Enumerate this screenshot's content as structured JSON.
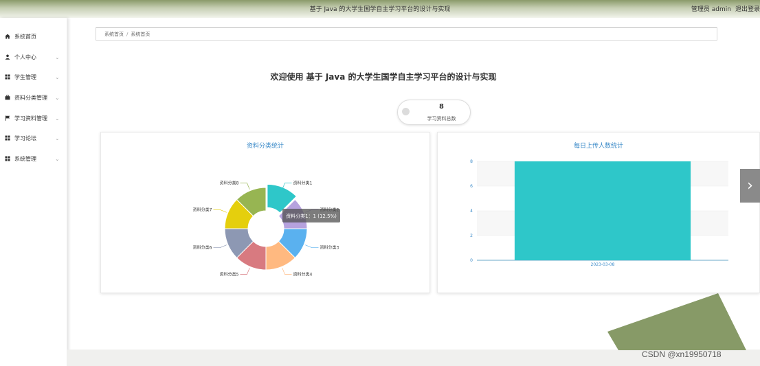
{
  "header": {
    "title": "基于 Java 的大学生国学自主学习平台的设计与实现",
    "user": "管理员 admin",
    "logout": "退出登录"
  },
  "sidebar": {
    "items": [
      {
        "label": "系统首页",
        "icon": "home-icon",
        "has_arrow": false
      },
      {
        "label": "个人中心",
        "icon": "user-icon",
        "has_arrow": true
      },
      {
        "label": "学生管理",
        "icon": "grid-icon",
        "has_arrow": true
      },
      {
        "label": "资料分类管理",
        "icon": "briefcase-icon",
        "has_arrow": true
      },
      {
        "label": "学习资料管理",
        "icon": "flag-icon",
        "has_arrow": true
      },
      {
        "label": "学习论坛",
        "icon": "grid-icon",
        "has_arrow": true
      },
      {
        "label": "系统管理",
        "icon": "grid-icon",
        "has_arrow": true
      }
    ]
  },
  "breadcrumb": {
    "items": [
      "系统首页",
      "系统首页"
    ],
    "separator": "/"
  },
  "welcome": "欢迎使用 基于 Java 的大学生国学自主学习平台的设计与实现",
  "stats": {
    "value": "8",
    "label": "学习资料总数"
  },
  "pie_panel": {
    "title": "资料分类统计"
  },
  "bar_panel": {
    "title": "每日上传人数统计"
  },
  "tooltip": "资料分类1：1 (12.5%)",
  "watermark": "CSDN @xn19950718",
  "colors": {
    "accent": "#3a8ac8",
    "header_green": "#8a9a6a",
    "bar": "#2ec7c9"
  },
  "chart_data": [
    {
      "type": "pie",
      "title": "资料分类统计",
      "variant": "donut",
      "categories": [
        "资料分类1",
        "资料分类2",
        "资料分类3",
        "资料分类4",
        "资料分类5",
        "资料分类6",
        "资料分类7",
        "资料分类8"
      ],
      "values": [
        1,
        1,
        1,
        1,
        1,
        1,
        1,
        1
      ],
      "colors": [
        "#2ec7c9",
        "#b6a2de",
        "#5ab1ef",
        "#ffb980",
        "#d87a80",
        "#8d98b3",
        "#e5cf0d",
        "#97b552"
      ],
      "highlighted": "资料分类1"
    },
    {
      "type": "bar",
      "title": "每日上传人数统计",
      "categories": [
        "2023-03-08"
      ],
      "values": [
        8
      ],
      "ylim": [
        0,
        8
      ],
      "yticks": [
        0,
        2,
        4,
        6,
        8
      ],
      "color": "#2ec7c9"
    }
  ]
}
